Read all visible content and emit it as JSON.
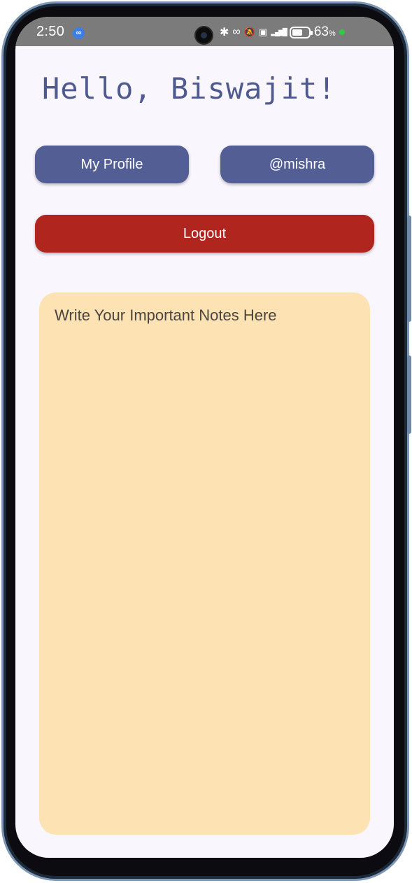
{
  "status_bar": {
    "time": "2:50",
    "link_badge": "∞",
    "icons": [
      "bluetooth-icon",
      "link-icon",
      "bell-off-icon",
      "volte-icon",
      "signal-5g-icon"
    ],
    "bluetooth_glyph": "✱",
    "link_glyph": "∞",
    "bell_glyph": "🔕",
    "volte_glyph": "▣",
    "signal_glyph": "▂▄▆█",
    "battery_level": 0.63,
    "battery_text": "63",
    "battery_unit": "%",
    "indicator_color": "#2ecc40"
  },
  "greeting": "Hello, Biswajit!",
  "buttons": {
    "profile": "My Profile",
    "handle": "@mishra",
    "logout": "Logout"
  },
  "notes": {
    "placeholder": "Write Your Important Notes Here",
    "value": ""
  },
  "colors": {
    "primary": "#535e95",
    "danger": "#b1251f",
    "notes_bg": "#fde3b4",
    "screen_bg": "#f9f6fe"
  }
}
